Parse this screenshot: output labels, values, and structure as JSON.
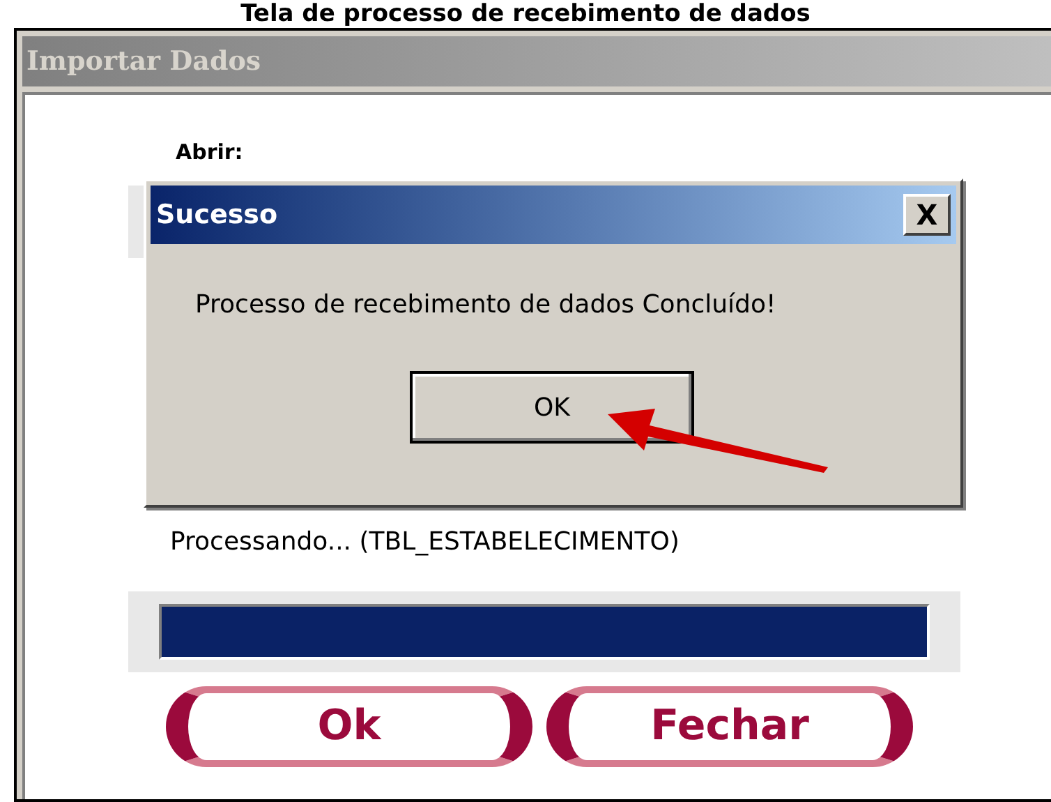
{
  "heading": "Tela de processo de recebimento de dados",
  "window": {
    "title": "Importar Dados",
    "open_label": "Abrir:"
  },
  "dialog": {
    "title": "Sucesso",
    "close": "X",
    "message": "Processo de recebimento de dados Concluído!",
    "button": "OK"
  },
  "status": "Processando... (TBL_ESTABELECIMENTO)",
  "progress": {
    "level": 1
  },
  "buttons": [
    "Ok",
    "Fechar"
  ]
}
